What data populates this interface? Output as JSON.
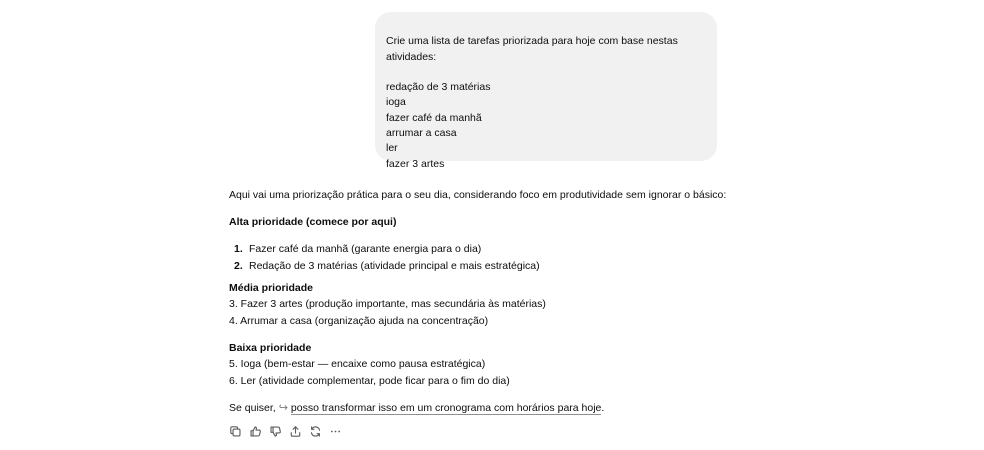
{
  "user_message": {
    "text": "Crie uma lista de tarefas priorizada para hoje com base nestas\natividades:\n\nredação de 3 matérias\nioga\nfazer café da manhã\narrumar a casa\nler\nfazer 3 artes"
  },
  "assistant": {
    "intro": "Aqui vai uma priorização prática para o seu dia, considerando foco em produtividade sem ignorar o básico:",
    "high": {
      "heading": "Alta prioridade (comece por aqui)",
      "items": [
        {
          "num": "1.",
          "text": "Fazer café da manhã (garante energia para o dia)"
        },
        {
          "num": "2.",
          "text": "Redação de 3 matérias (atividade principal e mais estratégica)"
        }
      ]
    },
    "medium": {
      "heading": "Média prioridade",
      "items": [
        "3. Fazer 3 artes (produção importante, mas secundária às matérias)",
        "4. Arrumar a casa (organização ajuda na concentração)"
      ]
    },
    "low": {
      "heading": "Baixa prioridade",
      "items": [
        "5. Ioga (bem-estar — encaixe como pausa estratégica)",
        "6. Ler (atividade complementar, pode ficar para o fim do dia)"
      ]
    },
    "closing_prefix": "Se quiser,",
    "closing_link": "posso transformar isso em um cronograma com horários para hoje",
    "closing_suffix": "."
  },
  "toolbar": {
    "icons": [
      "copy-icon",
      "thumbs-up-icon",
      "thumbs-down-icon",
      "share-icon",
      "regenerate-icon",
      "more-icon"
    ]
  }
}
